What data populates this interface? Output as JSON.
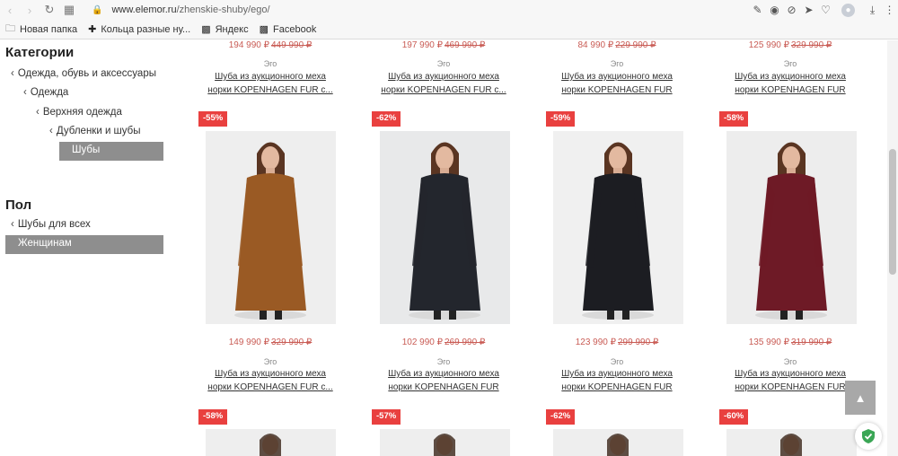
{
  "browser": {
    "url_host": "www.elemor.ru",
    "url_path": "/zhenskie-shuby/ego/",
    "bookmarks": [
      {
        "label": "Новая папка",
        "icon": "folder-icon"
      },
      {
        "label": "Кольца разные ну...",
        "icon": "plus-circle-icon"
      },
      {
        "label": "Яндекс",
        "icon": "page-icon"
      },
      {
        "label": "Facebook",
        "icon": "page-icon"
      }
    ]
  },
  "sidebar": {
    "categories_title": "Категории",
    "categories": [
      "Одежда, обувь и аксессуары",
      "Одежда",
      "Верхняя одежда",
      "Дубленки и шубы"
    ],
    "active_category": "Шубы",
    "gender_title": "Пол",
    "gender_parent": "Шубы для всех",
    "active_gender": "Женщинам"
  },
  "top_row": [
    {
      "price": "194 990 ₽",
      "old_price": "449 990 ₽",
      "brand": "Эго",
      "name1": "Шуба из аукционного меха",
      "name2": "норки KOPENHAGEN FUR с..."
    },
    {
      "price": "197 990 ₽",
      "old_price": "469 990 ₽",
      "brand": "Эго",
      "name1": "Шуба из аукционного меха",
      "name2": "норки KOPENHAGEN FUR с..."
    },
    {
      "price": "84 990 ₽",
      "old_price": "229 990 ₽",
      "brand": "Эго",
      "name1": "Шуба из аукционного меха",
      "name2": "норки KOPENHAGEN FUR"
    },
    {
      "price": "125 990 ₽",
      "old_price": "329 990 ₽",
      "brand": "Эго",
      "name1": "Шуба из аукционного меха",
      "name2": "норки KOPENHAGEN FUR"
    }
  ],
  "mid_row": [
    {
      "discount": "-55%",
      "price": "149 990 ₽",
      "old_price": "329 990 ₽",
      "brand": "Эго",
      "name1": "Шуба из аукционного меха",
      "name2": "норки KOPENHAGEN FUR с...",
      "coat_color": "#9a5a24",
      "bg": "#eeeeee"
    },
    {
      "discount": "-62%",
      "price": "102 990 ₽",
      "old_price": "269 990 ₽",
      "brand": "Эго",
      "name1": "Шуба из аукционного меха",
      "name2": "норки KOPENHAGEN FUR",
      "coat_color": "#23262d",
      "bg": "#e8e9ea"
    },
    {
      "discount": "-59%",
      "price": "123 990 ₽",
      "old_price": "299 990 ₽",
      "brand": "Эго",
      "name1": "Шуба из аукционного меха",
      "name2": "норки KOPENHAGEN FUR",
      "coat_color": "#1c1d22",
      "bg": "#f0f0f0"
    },
    {
      "discount": "-58%",
      "price": "135 990 ₽",
      "old_price": "319 990 ₽",
      "brand": "Эго",
      "name1": "Шуба из аукционного меха",
      "name2": "норки KOPENHAGEN FUR",
      "coat_color": "#6e1a26",
      "bg": "#ededed"
    }
  ],
  "bottom_row": [
    {
      "discount": "-58%"
    },
    {
      "discount": "-57%"
    },
    {
      "discount": "-62%"
    },
    {
      "discount": "-60%"
    }
  ]
}
